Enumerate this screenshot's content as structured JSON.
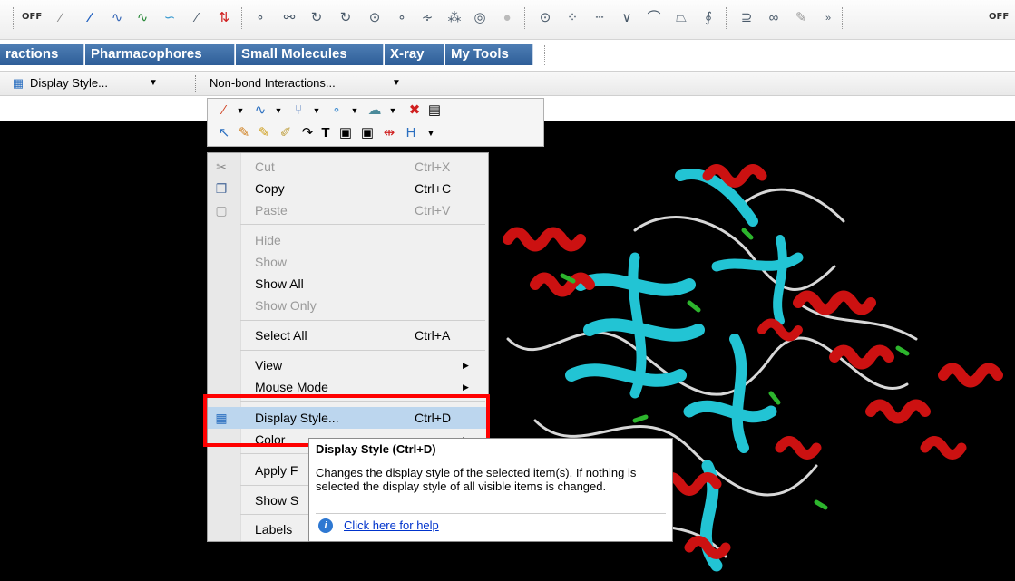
{
  "toolbar": {
    "off_left": "OFF",
    "off_right": "OFF",
    "icons": [
      "dotted-separator",
      "off-toggle",
      "line-thin-icon",
      "line-blue-icon",
      "ribbon-icon",
      "ribbon-green-icon",
      "ribbon-colored-icon",
      "tube-icon",
      "hbond-icon",
      "atom-label-icon",
      "bond-tool-icon",
      "ring-tool-icon",
      "chain-tool-icon",
      "ring-add-icon",
      "charge-icon",
      "clean-icon",
      "disc-icon",
      "ring-icon-a",
      "ring-icon-b",
      "dash-tool-icon",
      "angle-tool-icon",
      "torsion-tool-icon",
      "polygon-tool-icon",
      "fragment-icon",
      "loop-icon",
      "link-icon",
      "pencil-icon",
      "overflow-chevron-icon"
    ]
  },
  "tabs": [
    {
      "label": "ractions"
    },
    {
      "label": "Pharmacophores"
    },
    {
      "label": "Small Molecules"
    },
    {
      "label": "X-ray"
    },
    {
      "label": "My Tools"
    }
  ],
  "stylebar": {
    "display_style": "Display Style...",
    "non_bond": "Non-bond Interactions..."
  },
  "drawbar": {
    "text_tool": "T"
  },
  "context_menu": {
    "items": [
      {
        "label": "Cut",
        "shortcut": "Ctrl+X",
        "enabled": false,
        "icon": "scissors-icon"
      },
      {
        "label": "Copy",
        "shortcut": "Ctrl+C",
        "enabled": true,
        "icon": "copy-icon"
      },
      {
        "label": "Paste",
        "shortcut": "Ctrl+V",
        "enabled": false,
        "icon": "paste-icon"
      },
      {
        "label": "Hide",
        "shortcut": "",
        "enabled": false
      },
      {
        "label": "Show",
        "shortcut": "",
        "enabled": false
      },
      {
        "label": "Show All",
        "shortcut": "",
        "enabled": true
      },
      {
        "label": "Show Only",
        "shortcut": "",
        "enabled": false
      },
      {
        "label": "Select All",
        "shortcut": "Ctrl+A",
        "enabled": true
      },
      {
        "label": "View",
        "shortcut": "",
        "enabled": true,
        "submenu": true
      },
      {
        "label": "Mouse Mode",
        "shortcut": "",
        "enabled": true,
        "submenu": true
      },
      {
        "label": "Display Style...",
        "shortcut": "Ctrl+D",
        "enabled": true,
        "highlighted": true,
        "icon": "display-style-icon"
      },
      {
        "label": "Color",
        "shortcut": "",
        "enabled": true,
        "submenu": true
      },
      {
        "label": "Apply F",
        "shortcut": "",
        "enabled": true
      },
      {
        "label": "Show S",
        "shortcut": "",
        "enabled": true
      },
      {
        "label": "Labels",
        "shortcut": "",
        "enabled": true
      }
    ]
  },
  "tooltip": {
    "title": "Display Style (Ctrl+D)",
    "body": "Changes the display style of the selected item(s). If nothing is selected the display style of all visible items is changed.",
    "help_link": "Click here for help"
  },
  "colors": {
    "tab_blue": "#2e5e98",
    "highlight": "#bcd6ee",
    "annotation_red": "#ff0000",
    "helix_red": "#cc1111",
    "sheet_cyan": "#22c4d4",
    "turn_green": "#2db52d",
    "coil_white": "#d8d8d8"
  }
}
